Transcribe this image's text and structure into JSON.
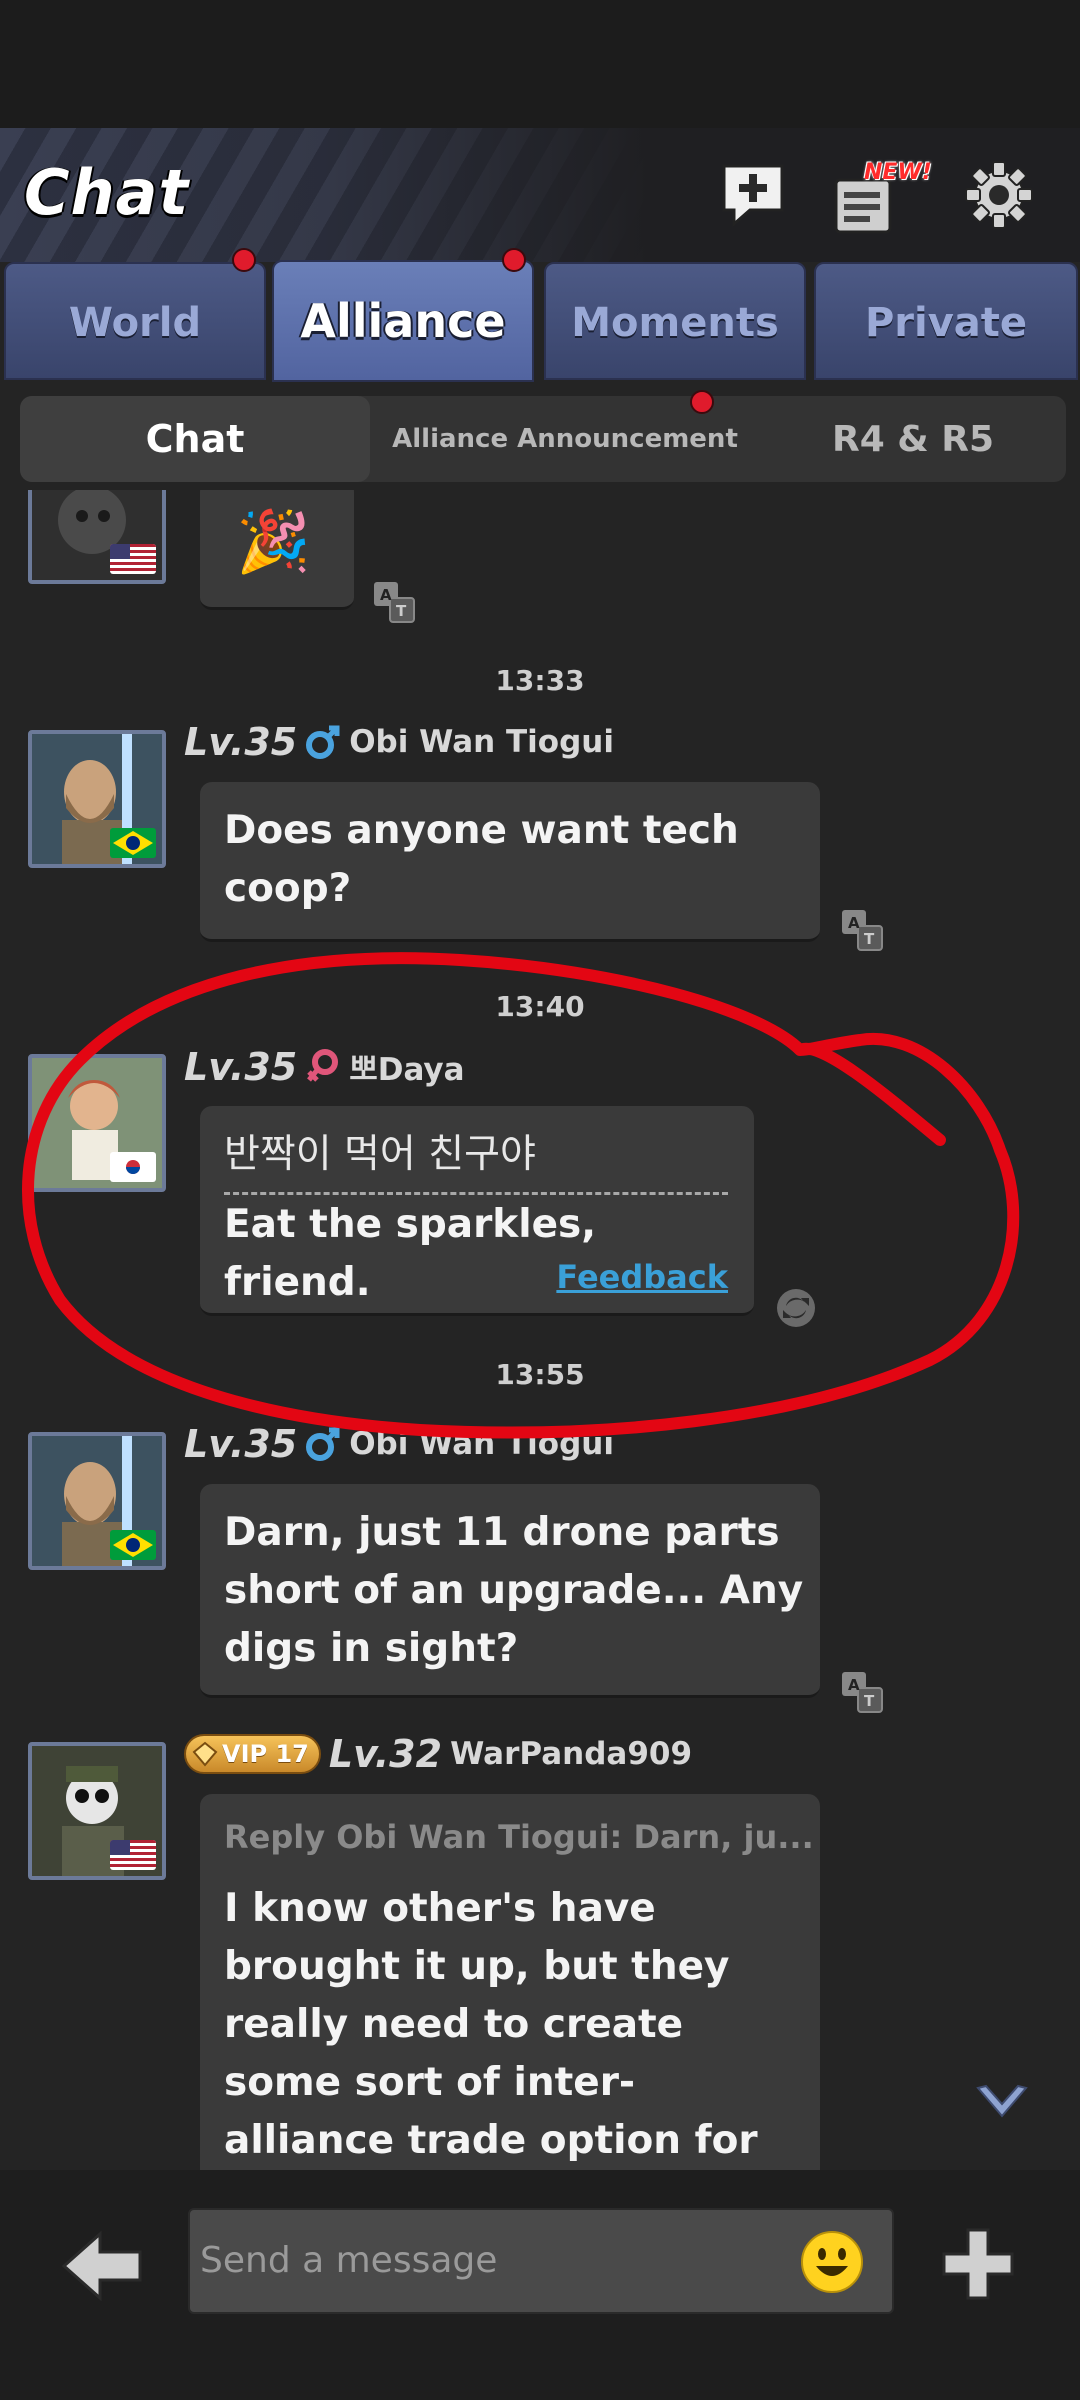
{
  "header": {
    "title": "Chat",
    "new_badge": "NEW!"
  },
  "tabs": [
    {
      "label": "World",
      "active": false,
      "has_dot": true
    },
    {
      "label": "Alliance",
      "active": true,
      "has_dot": true
    },
    {
      "label": "Moments",
      "active": false,
      "has_dot": false
    },
    {
      "label": "Private",
      "active": false,
      "has_dot": false
    }
  ],
  "subtabs": [
    {
      "label": "Chat",
      "active": true
    },
    {
      "label": "Alliance Announcement",
      "active": false,
      "has_dot": true
    },
    {
      "label": "R4 & R5",
      "active": false
    }
  ],
  "messages": [
    {
      "type": "emoji",
      "emoji": "🎉",
      "flag": "us"
    },
    {
      "time": "13:33"
    },
    {
      "level": "Lv.35",
      "gender": "male",
      "name": "Obi Wan Tiogui",
      "flag": "br",
      "text": [
        "Does anyone want tech",
        "coop?"
      ]
    },
    {
      "time": "13:40"
    },
    {
      "level": "Lv.35",
      "gender": "female",
      "name": "뽀Daya",
      "flag": "kr",
      "original": "반짝이 먹어 친구야",
      "translation": "Eat the sparkles, friend.",
      "feedback": "Feedback"
    },
    {
      "time": "13:55"
    },
    {
      "level": "Lv.35",
      "gender": "male",
      "name": "Obi Wan Tiogui",
      "flag": "br",
      "text": [
        "Darn, just 11 drone parts",
        "short of an upgrade... Any",
        "digs in sight?"
      ]
    },
    {
      "vip": "VIP 17",
      "level": "Lv.32",
      "name": "WarPanda909",
      "flag": "us",
      "reply": "Reply Obi Wan Tiogui: Darn, ju...",
      "text": [
        "I know other's have",
        "brought it up, but they",
        "really need to create",
        "some sort of inter-",
        "alliance trade option for"
      ]
    }
  ],
  "input": {
    "placeholder": "Send a message"
  },
  "colors": {
    "accent_tab": "#5264a0",
    "feedback_link": "#3aa0d8",
    "annotation": "#e30613"
  }
}
